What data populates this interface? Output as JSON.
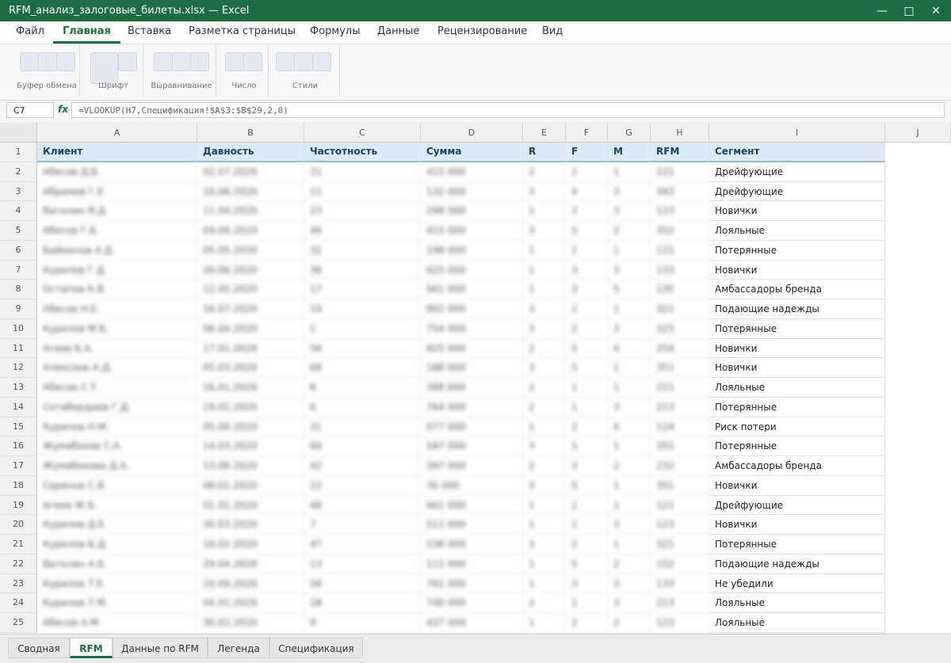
{
  "window": {
    "title": "RFM_анализ_залоговые_билеты.xlsx — Excel",
    "minimize": "—",
    "maximize": "□",
    "close": "✕"
  },
  "menu": [
    "Файл",
    "Главная",
    "Вставка",
    "Разметка страницы",
    "Формулы",
    "Данные",
    "Рецензирование",
    "Вид"
  ],
  "menu_active": "Главная",
  "ribbon": [
    "Буфер обмена",
    "Шрифт",
    "Выравнивание",
    "Число",
    "Стили"
  ],
  "formula_bar": {
    "cell_ref": "C7",
    "fx": "fx",
    "formula": "=VLOOKUP(H7,Спецификация!$A$3:$B$29,2,0)"
  },
  "columns": [
    "A",
    "B",
    "C",
    "D",
    "E",
    "F",
    "G",
    "H",
    "I",
    "J"
  ],
  "header_row": [
    "Клиент",
    "Давность",
    "Частотность",
    "Сумма",
    "R",
    "F",
    "M",
    "RFM",
    "Сегмент"
  ],
  "rows": [
    {
      "n": "2",
      "client": "Абесов Д.Б.",
      "recency": "02.07.2020",
      "freq": "21",
      "sum": "415 000",
      "r": "2",
      "f": "2",
      "m": "1",
      "rfm": "221",
      "segment": "Дрейфующие"
    },
    {
      "n": "3",
      "client": "Абрамов Г.Е.",
      "recency": "10.06.2020",
      "freq": "11",
      "sum": "132 000",
      "r": "3",
      "f": "4",
      "m": "3",
      "rfm": "343",
      "segment": "Дрейфующие"
    },
    {
      "n": "4",
      "client": "Ватолин Я.Д.",
      "recency": "11.04.2020",
      "freq": "23",
      "sum": "298 000",
      "r": "1",
      "f": "2",
      "m": "3",
      "rfm": "123",
      "segment": "Новички"
    },
    {
      "n": "5",
      "client": "Абесов Г.Б.",
      "recency": "09.06.2020",
      "freq": "46",
      "sum": "415 000",
      "r": "3",
      "f": "5",
      "m": "2",
      "rfm": "352",
      "segment": "Лояльные"
    },
    {
      "n": "6",
      "client": "Байменов А.Д.",
      "recency": "05.05.2020",
      "freq": "32",
      "sum": "198 000",
      "r": "1",
      "f": "2",
      "m": "1",
      "rfm": "121",
      "segment": "Потерянные"
    },
    {
      "n": "7",
      "client": "Курилов Г.Д.",
      "recency": "20.08.2020",
      "freq": "36",
      "sum": "625 000",
      "r": "1",
      "f": "3",
      "m": "3",
      "rfm": "133",
      "segment": "Новички"
    },
    {
      "n": "8",
      "client": "Остапов К.В.",
      "recency": "12.05.2020",
      "freq": "17",
      "sum": "561 000",
      "r": "1",
      "f": "3",
      "m": "5",
      "rfm": "135",
      "segment": "Амбассадоры бренда"
    },
    {
      "n": "9",
      "client": "Абесов Н.Е.",
      "recency": "16.07.2020",
      "freq": "19",
      "sum": "802 000",
      "r": "3",
      "f": "2",
      "m": "1",
      "rfm": "321",
      "segment": "Подающие надежды"
    },
    {
      "n": "10",
      "client": "Курилов М.Б.",
      "recency": "06.04.2020",
      "freq": "1",
      "sum": "754 000",
      "r": "3",
      "f": "2",
      "m": "3",
      "rfm": "323",
      "segment": "Потерянные"
    },
    {
      "n": "11",
      "client": "Агеев Б.А.",
      "recency": "17.01.2020",
      "freq": "56",
      "sum": "825 000",
      "r": "2",
      "f": "5",
      "m": "4",
      "rfm": "254",
      "segment": "Новички"
    },
    {
      "n": "12",
      "client": "Алексеев А.Д.",
      "recency": "05.03.2020",
      "freq": "68",
      "sum": "188 000",
      "r": "3",
      "f": "5",
      "m": "1",
      "rfm": "351",
      "segment": "Новички"
    },
    {
      "n": "13",
      "client": "Абесов С.Т.",
      "recency": "16.01.2020",
      "freq": "8",
      "sum": "388 000",
      "r": "2",
      "f": "1",
      "m": "1",
      "rfm": "211",
      "segment": "Лояльные"
    },
    {
      "n": "14",
      "client": "Сотабердиев Г.Д.",
      "recency": "19.01.2020",
      "freq": "6",
      "sum": "764 000",
      "r": "2",
      "f": "1",
      "m": "3",
      "rfm": "213",
      "segment": "Потерянные"
    },
    {
      "n": "15",
      "client": "Курилов Н.М.",
      "recency": "05.06.2020",
      "freq": "31",
      "sum": "077 000",
      "r": "1",
      "f": "2",
      "m": "4",
      "rfm": "124",
      "segment": "Риск потери"
    },
    {
      "n": "16",
      "client": "Жумабеков С.А.",
      "recency": "14.03.2020",
      "freq": "60",
      "sum": "587 000",
      "r": "3",
      "f": "5",
      "m": "1",
      "rfm": "351",
      "segment": "Потерянные"
    },
    {
      "n": "17",
      "client": "Жумабекова Д.А.",
      "recency": "13.06.2020",
      "freq": "42",
      "sum": "397 000",
      "r": "2",
      "f": "3",
      "m": "2",
      "rfm": "232",
      "segment": "Амбассадоры бренда"
    },
    {
      "n": "18",
      "client": "Серенов С.В.",
      "recency": "08.01.2020",
      "freq": "22",
      "sum": "36 000",
      "r": "3",
      "f": "5",
      "m": "1",
      "rfm": "351",
      "segment": "Новички"
    },
    {
      "n": "19",
      "client": "Агеев Ж.Б.",
      "recency": "01.01.2020",
      "freq": "46",
      "sum": "661 000",
      "r": "1",
      "f": "2",
      "m": "1",
      "rfm": "121",
      "segment": "Дрейфующие"
    },
    {
      "n": "20",
      "client": "Курилов Д.Е.",
      "recency": "30.03.2020",
      "freq": "7",
      "sum": "511 000",
      "r": "1",
      "f": "2",
      "m": "3",
      "rfm": "123",
      "segment": "Новички"
    },
    {
      "n": "21",
      "client": "Курилов Б.Д.",
      "recency": "10.02.2020",
      "freq": "47",
      "sum": "538 000",
      "r": "3",
      "f": "2",
      "m": "1",
      "rfm": "321",
      "segment": "Потерянные"
    },
    {
      "n": "22",
      "client": "Ватолин А.Б.",
      "recency": "29.04.2020",
      "freq": "13",
      "sum": "111 000",
      "r": "1",
      "f": "5",
      "m": "2",
      "rfm": "152",
      "segment": "Подающие надежды"
    },
    {
      "n": "23",
      "client": "Курилов Т.Е.",
      "recency": "10.09.2020",
      "freq": "56",
      "sum": "761 000",
      "r": "1",
      "f": "3",
      "m": "3",
      "rfm": "133",
      "segment": "Не убедили"
    },
    {
      "n": "24",
      "client": "Курилов Т.М.",
      "recency": "04.01.2020",
      "freq": "28",
      "sum": "740 000",
      "r": "2",
      "f": "1",
      "m": "3",
      "rfm": "213",
      "segment": "Лояльные"
    },
    {
      "n": "25",
      "client": "Абесов А.М.",
      "recency": "30.02.2020",
      "freq": "9",
      "sum": "437 000",
      "r": "1",
      "f": "2",
      "m": "2",
      "rfm": "122",
      "segment": "Лояльные"
    }
  ],
  "sheets": [
    "Сводная",
    "RFM",
    "Данные по RFM",
    "Легенда",
    "Спецификация"
  ],
  "active_sheet": "RFM",
  "colors": {
    "accent": "#1e6c42",
    "header_fill": "#dce9f6",
    "header_text": "#1f3f6b"
  }
}
